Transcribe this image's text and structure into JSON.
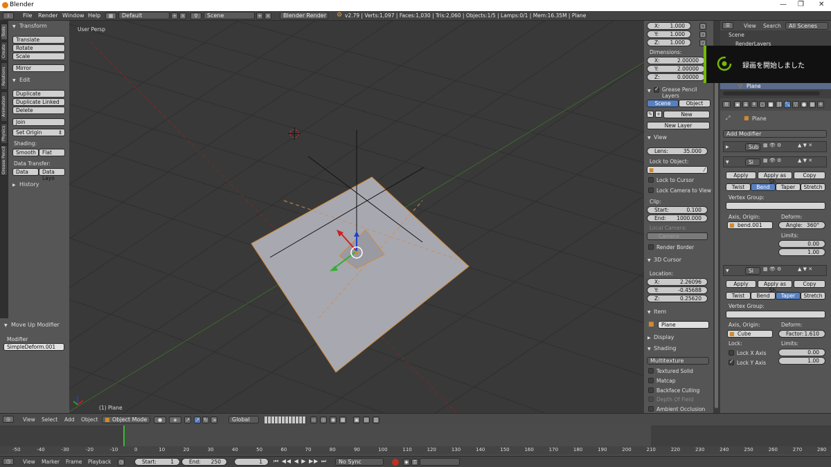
{
  "window": {
    "title": "Blender",
    "min": "—",
    "max": "❐",
    "close": "✕"
  },
  "infobar": {
    "menus": [
      "File",
      "Render",
      "Window",
      "Help"
    ],
    "layout": "Default",
    "scene": "Scene",
    "engine": "Blender Render",
    "stats": "v2.79 | Verts:1,097 | Faces:1,030 | Tris:2,060 | Objects:1/5 | Lamps:0/1 | Mem:16.35M | Plane"
  },
  "tabs": [
    "Tools",
    "Create",
    "Relations",
    "Animation",
    "Physics",
    "Grease Pencil"
  ],
  "toolshelf": {
    "transform": {
      "title": "Transform",
      "buttons": [
        "Translate",
        "Rotate",
        "Scale",
        "Mirror"
      ]
    },
    "edit": {
      "title": "Edit",
      "buttons": [
        "Duplicate",
        "Duplicate Linked",
        "Delete",
        "Join"
      ],
      "set_origin": "Set Origin"
    },
    "shading": {
      "label": "Shading:",
      "smooth": "Smooth",
      "flat": "Flat"
    },
    "data_transfer": {
      "label": "Data Transfer:",
      "data": "Data",
      "data_layo": "Data Layo"
    },
    "history": "History"
  },
  "operator": {
    "title": "Move Up Modifier",
    "label": "Modifier",
    "value": "SimpleDeform.001"
  },
  "viewport": {
    "label_top": "User Persp",
    "label_bottom": "(1) Plane"
  },
  "npanel": {
    "scale": [
      {
        "k": "X:",
        "v": "1.000"
      },
      {
        "k": "Y:",
        "v": "1.000"
      },
      {
        "k": "Z:",
        "v": "1.000"
      }
    ],
    "dimensions_label": "Dimensions:",
    "dimensions": [
      {
        "k": "X:",
        "v": "2.00000"
      },
      {
        "k": "Y:",
        "v": "2.00000"
      },
      {
        "k": "Z:",
        "v": "0.00000"
      }
    ],
    "grease": {
      "title": "Grease Pencil Layers",
      "scene": "Scene",
      "object": "Object",
      "new": "New",
      "new_layer": "New Layer"
    },
    "view": {
      "title": "View",
      "lens_k": "Lens:",
      "lens_v": "35.000",
      "lock_label": "Lock to Object:",
      "lock_cursor": "Lock to Cursor",
      "lock_camera": "Lock Camera to View",
      "clip": "Clip:",
      "start_k": "Start:",
      "start_v": "0.100",
      "end_k": "End:",
      "end_v": "1000.000",
      "local_camera": "Local Camera:",
      "camera": "Camera",
      "render_border": "Render Border"
    },
    "cursor": {
      "title": "3D Cursor",
      "location": "Location:",
      "x": "2.26096",
      "y": "-0.45688",
      "z": "0.25620"
    },
    "item": {
      "title": "Item",
      "name": "Plane"
    },
    "display": "Display",
    "shading": {
      "title": "Shading",
      "mode": "Multitexture",
      "opts": [
        "Textured Solid",
        "Matcap",
        "Backface Culling",
        "Depth Of Field",
        "Ambient Occlusion"
      ]
    }
  },
  "outliner": {
    "view": "View",
    "search": "Search",
    "filter": "All Scenes",
    "scene": "Scene",
    "render": "RenderLayers",
    "plane": "Plane"
  },
  "toast": {
    "text": "録画を開始しました"
  },
  "props": {
    "object": "Plane",
    "add_modifier": "Add Modifier",
    "mod1": {
      "name": "Sub"
    },
    "mod2": {
      "name": "Si",
      "apply": "Apply",
      "apply_as": "Apply as Sh...",
      "copy": "Copy",
      "modes": [
        "Twist",
        "Bend",
        "Taper",
        "Stretch"
      ],
      "active": 1,
      "vgroup": "Vertex Group:",
      "axis_label": "Axis, Origin:",
      "axis": "bend.001",
      "deform_label": "Deform:",
      "angle_k": "Angle:",
      "angle_v": "360°",
      "limits": "Limits:",
      "lim_min": "0.00",
      "lim_max": "1.00"
    },
    "mod3": {
      "name": "Si",
      "apply": "Apply",
      "apply_as": "Apply as Sh...",
      "copy": "Copy",
      "modes": [
        "Twist",
        "Bend",
        "Taper",
        "Stretch"
      ],
      "active": 2,
      "vgroup": "Vertex Group:",
      "axis_label": "Axis, Origin:",
      "axis": "Cube",
      "deform_label": "Deform:",
      "factor_k": "Factor:",
      "factor_v": "1.610",
      "lock": "Lock:",
      "lock_x": "Lock X Axis",
      "lock_y": "Lock Y Axis",
      "limits": "Limits:",
      "lim_min": "0.00",
      "lim_max": "1.00"
    }
  },
  "vbar": {
    "view": "View",
    "select": "Select",
    "add": "Add",
    "object": "Object",
    "mode": "Object Mode",
    "orientation": "Global"
  },
  "timeline": {
    "ticks": [
      "-50",
      "-40",
      "-30",
      "-20",
      "-10",
      "0",
      "10",
      "20",
      "30",
      "40",
      "50",
      "60",
      "70",
      "80",
      "90",
      "100",
      "110",
      "120",
      "130",
      "140",
      "150",
      "160",
      "170",
      "180",
      "190",
      "200",
      "210",
      "220",
      "230",
      "240",
      "250",
      "260",
      "270",
      "280"
    ],
    "view": "View",
    "marker": "Marker",
    "frame": "Frame",
    "playback": "Playback",
    "start_k": "Start:",
    "start_v": "1",
    "end_k": "End:",
    "end_v": "250",
    "current": "1",
    "sync": "No Sync"
  }
}
